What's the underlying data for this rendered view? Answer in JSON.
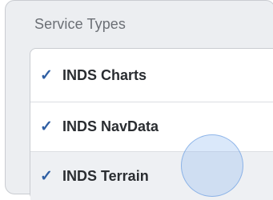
{
  "section": {
    "title": "Service Types"
  },
  "items": [
    {
      "check": "✓",
      "label": "INDS Charts"
    },
    {
      "check": "✓",
      "label": "INDS NavData"
    },
    {
      "check": "✓",
      "label": "INDS Terrain"
    }
  ],
  "colors": {
    "check": "#2f5fa3",
    "panel_bg": "#eceef1",
    "list_bg": "#ffffff"
  }
}
